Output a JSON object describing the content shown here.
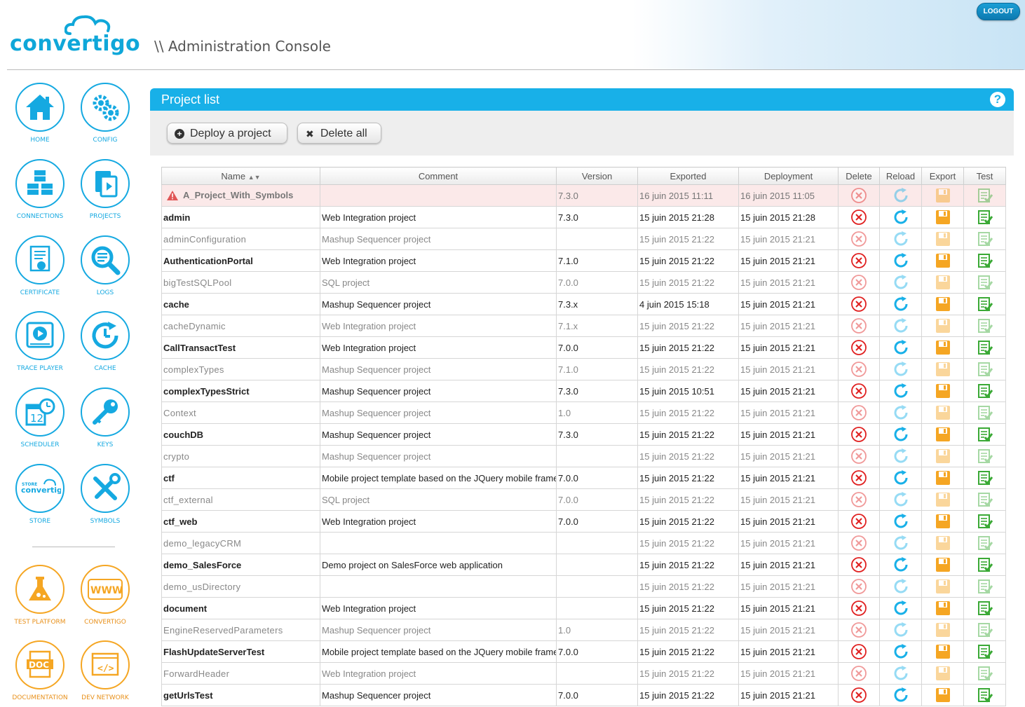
{
  "header": {
    "logo_text": "convertigo",
    "title": "\\\\ Administration Console",
    "logout_label": "LOGOUT"
  },
  "sidebar": {
    "items": [
      {
        "label": "HOME",
        "icon": "home-icon"
      },
      {
        "label": "CONFIG",
        "icon": "gears-icon"
      },
      {
        "label": "CONNECTIONS",
        "icon": "cubes-icon"
      },
      {
        "label": "PROJECTS",
        "icon": "projects-icon"
      },
      {
        "label": "CERTIFICATE",
        "icon": "certificate-icon"
      },
      {
        "label": "LOGS",
        "icon": "magnifier-icon"
      },
      {
        "label": "TRACE PLAYER",
        "icon": "play-icon"
      },
      {
        "label": "CACHE",
        "icon": "clock-refresh-icon"
      },
      {
        "label": "SCHEDULER",
        "icon": "calendar-clock-icon"
      },
      {
        "label": "KEYS",
        "icon": "key-icon"
      },
      {
        "label": "STORE",
        "icon": "store-icon"
      },
      {
        "label": "SYMBOLS",
        "icon": "tools-icon"
      },
      {
        "label": "TEST PLATFORM",
        "icon": "flask-icon"
      },
      {
        "label": "CONVERTIGO",
        "icon": "www-icon"
      },
      {
        "label": "DOCUMENTATION",
        "icon": "doc-icon"
      },
      {
        "label": "DEV NETWORK",
        "icon": "code-icon"
      }
    ],
    "store_logo_text": "convertigo",
    "store_logo_small": "STORE",
    "www_text": "WWW",
    "doc_text": "DOC",
    "code_text": "</>"
  },
  "panel": {
    "title": "Project list",
    "help_label": "?",
    "deploy_label": "Deploy a project",
    "delete_all_label": "Delete all"
  },
  "table": {
    "headers": [
      "Name",
      "Comment",
      "Version",
      "Exported",
      "Deployment",
      "Delete",
      "Reload",
      "Export",
      "Test"
    ],
    "rows": [
      {
        "name": "A_Project_With_Symbols",
        "comment": "",
        "version": "7.3.0",
        "exported": "16 juin 2015 11:11",
        "deployment": "16 juin 2015 11:05",
        "state": "error"
      },
      {
        "name": "admin",
        "comment": "Web Integration project",
        "version": "7.3.0",
        "exported": "15 juin 2015 21:28",
        "deployment": "15 juin 2015 21:28",
        "state": "active"
      },
      {
        "name": "adminConfiguration",
        "comment": "Mashup Sequencer project",
        "version": "",
        "exported": "15 juin 2015 21:22",
        "deployment": "15 juin 2015 21:21",
        "state": "dim"
      },
      {
        "name": "AuthenticationPortal",
        "comment": "Web Integration project",
        "version": "7.1.0",
        "exported": "15 juin 2015 21:22",
        "deployment": "15 juin 2015 21:21",
        "state": "active"
      },
      {
        "name": "bigTestSQLPool",
        "comment": "SQL project",
        "version": "7.0.0",
        "exported": "15 juin 2015 21:22",
        "deployment": "15 juin 2015 21:21",
        "state": "dim"
      },
      {
        "name": "cache",
        "comment": "Mashup Sequencer project",
        "version": "7.3.x",
        "exported": "4 juin 2015 15:18",
        "deployment": "15 juin 2015 21:21",
        "state": "active"
      },
      {
        "name": "cacheDynamic",
        "comment": "Web Integration project",
        "version": "7.1.x",
        "exported": "15 juin 2015 21:22",
        "deployment": "15 juin 2015 21:21",
        "state": "dim"
      },
      {
        "name": "CallTransactTest",
        "comment": "Web Integration project",
        "version": "7.0.0",
        "exported": "15 juin 2015 21:22",
        "deployment": "15 juin 2015 21:21",
        "state": "active"
      },
      {
        "name": "complexTypes",
        "comment": "Mashup Sequencer project",
        "version": "7.1.0",
        "exported": "15 juin 2015 21:22",
        "deployment": "15 juin 2015 21:21",
        "state": "dim"
      },
      {
        "name": "complexTypesStrict",
        "comment": "Mashup Sequencer project",
        "version": "7.3.0",
        "exported": "15 juin 2015 10:51",
        "deployment": "15 juin 2015 21:21",
        "state": "active"
      },
      {
        "name": "Context",
        "comment": "Mashup Sequencer project",
        "version": "1.0",
        "exported": "15 juin 2015 21:22",
        "deployment": "15 juin 2015 21:21",
        "state": "dim"
      },
      {
        "name": "couchDB",
        "comment": "Mashup Sequencer project",
        "version": "7.3.0",
        "exported": "15 juin 2015 21:22",
        "deployment": "15 juin 2015 21:21",
        "state": "active"
      },
      {
        "name": "crypto",
        "comment": "Mashup Sequencer project",
        "version": "",
        "exported": "15 juin 2015 21:22",
        "deployment": "15 juin 2015 21:21",
        "state": "dim"
      },
      {
        "name": "ctf",
        "comment": "Mobile project template based on the JQuery mobile frame",
        "version": "7.0.0",
        "exported": "15 juin 2015 21:22",
        "deployment": "15 juin 2015 21:21",
        "state": "active"
      },
      {
        "name": "ctf_external",
        "comment": "SQL project",
        "version": "7.0.0",
        "exported": "15 juin 2015 21:22",
        "deployment": "15 juin 2015 21:21",
        "state": "dim"
      },
      {
        "name": "ctf_web",
        "comment": "Web Integration project",
        "version": "7.0.0",
        "exported": "15 juin 2015 21:22",
        "deployment": "15 juin 2015 21:21",
        "state": "active"
      },
      {
        "name": "demo_legacyCRM",
        "comment": "",
        "version": "",
        "exported": "15 juin 2015 21:22",
        "deployment": "15 juin 2015 21:21",
        "state": "dim"
      },
      {
        "name": "demo_SalesForce",
        "comment": "Demo project on SalesForce web application",
        "version": "",
        "exported": "15 juin 2015 21:22",
        "deployment": "15 juin 2015 21:21",
        "state": "active"
      },
      {
        "name": "demo_usDirectory",
        "comment": "",
        "version": "",
        "exported": "15 juin 2015 21:22",
        "deployment": "15 juin 2015 21:21",
        "state": "dim"
      },
      {
        "name": "document",
        "comment": "Web Integration project",
        "version": "",
        "exported": "15 juin 2015 21:22",
        "deployment": "15 juin 2015 21:21",
        "state": "active"
      },
      {
        "name": "EngineReservedParameters",
        "comment": "Mashup Sequencer project",
        "version": "1.0",
        "exported": "15 juin 2015 21:22",
        "deployment": "15 juin 2015 21:21",
        "state": "dim"
      },
      {
        "name": "FlashUpdateServerTest",
        "comment": "Mobile project template based on the JQuery mobile frame",
        "version": "7.0.0",
        "exported": "15 juin 2015 21:22",
        "deployment": "15 juin 2015 21:21",
        "state": "active"
      },
      {
        "name": "ForwardHeader",
        "comment": "Web Integration project",
        "version": "",
        "exported": "15 juin 2015 21:22",
        "deployment": "15 juin 2015 21:21",
        "state": "dim"
      },
      {
        "name": "getUrlsTest",
        "comment": "Mashup Sequencer project",
        "version": "7.0.0",
        "exported": "15 juin 2015 21:22",
        "deployment": "15 juin 2015 21:21",
        "state": "active"
      }
    ]
  },
  "colors": {
    "accent": "#18b0e8",
    "orange": "#f5a623",
    "delete_red": "#e02020",
    "test_green": "#3aa935",
    "error_row": "#fbe9e9"
  }
}
